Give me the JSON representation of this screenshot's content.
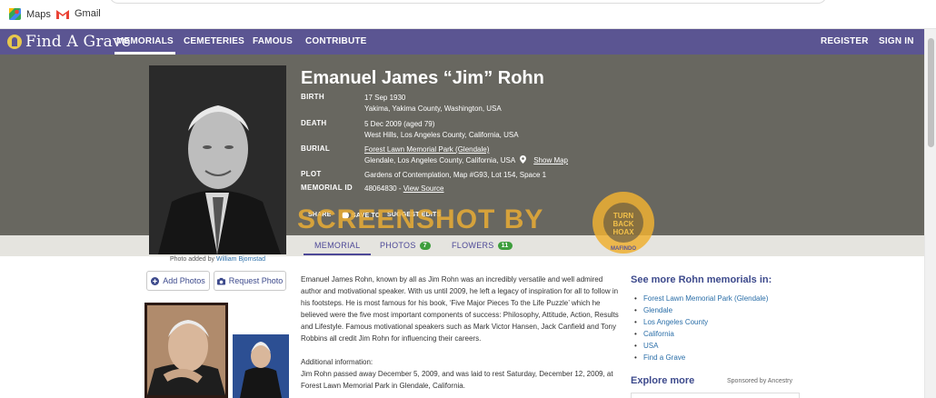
{
  "bookmarks": [
    {
      "label": "Maps"
    },
    {
      "label": "Gmail"
    }
  ],
  "nav": {
    "logo": "Find A Grave",
    "items": [
      "MEMORIALS",
      "CEMETERIES",
      "FAMOUS",
      "CONTRIBUTE"
    ],
    "active": "MEMORIALS",
    "register": "REGISTER",
    "sign_in": "SIGN IN",
    "color": "#5b5592"
  },
  "memorial": {
    "name": "Emanuel James “Jim” Rohn",
    "photo_caption": "Photo added by",
    "photo_credit": "William Bjornstad",
    "facts": {
      "birth_label": "BIRTH",
      "birth_date": "17 Sep 1930",
      "birth_place": "Yakima, Yakima County, Washington, USA",
      "death_label": "DEATH",
      "death_date": "5 Dec 2009 (aged 79)",
      "death_place": "West Hills, Los Angeles County, California, USA",
      "burial_label": "BURIAL",
      "burial_cemetery": "Forest Lawn Memorial Park (Glendale)",
      "burial_place": "Glendale, Los Angeles County, California, USA",
      "show_map": "Show Map",
      "plot_label": "PLOT",
      "plot": "Gardens of Contemplation, Map #G93, Lot 154, Space 1",
      "memorial_id_label": "MEMORIAL ID",
      "memorial_id": "48064830 -",
      "view_source": "View Source"
    },
    "actions": {
      "share": "SHARE",
      "save": "SAVE TO",
      "suggest": "SUGGEST EDITS"
    },
    "tabs": {
      "memorial": "MEMORIAL",
      "photos": "PHOTOS",
      "photos_count": "7",
      "flowers": "FLOWERS",
      "flowers_count": "11"
    },
    "buttons": {
      "add_photos": "Add Photos",
      "request_photo": "Request Photo"
    },
    "bio": {
      "p1": "Emanuel James Rohn, known by all as Jim Rohn was an incredibly versatile and well admired author and motivational speaker. With us until 2009, he left a legacy of inspiration for all to follow in his footsteps. He is most famous for his book, ‘Five Major Pieces To the Life Puzzle’ which he believed were the five most important components of success: Philosophy, Attitude, Action, Results and Lifestyle. Famous motivational speakers such as Mark Victor Hansen, Jack Canfield and Tony Robbins all credit Jim Rohn for influencing their careers.",
      "additional_heading": "Additional information:",
      "p2": "Jim Rohn passed away December 5, 2009, and was laid to rest Saturday, December 12, 2009, at Forest Lawn Memorial Park in Glendale, California."
    }
  },
  "rail": {
    "heading_prefix": "See more",
    "heading_name": "Rohn",
    "heading_suffix": "memorials in:",
    "links": [
      "Forest Lawn Memorial Park (Glendale)",
      "Glendale",
      "Los Angeles County",
      "California",
      "USA",
      "Find a Grave"
    ],
    "explore": "Explore more",
    "sponsor": "Sponsored by Ancestry"
  },
  "watermark": {
    "text": "SCREENSHOT BY",
    "seal_text": "TURN BACK HOAX",
    "seal_name": "MAFINDO"
  }
}
